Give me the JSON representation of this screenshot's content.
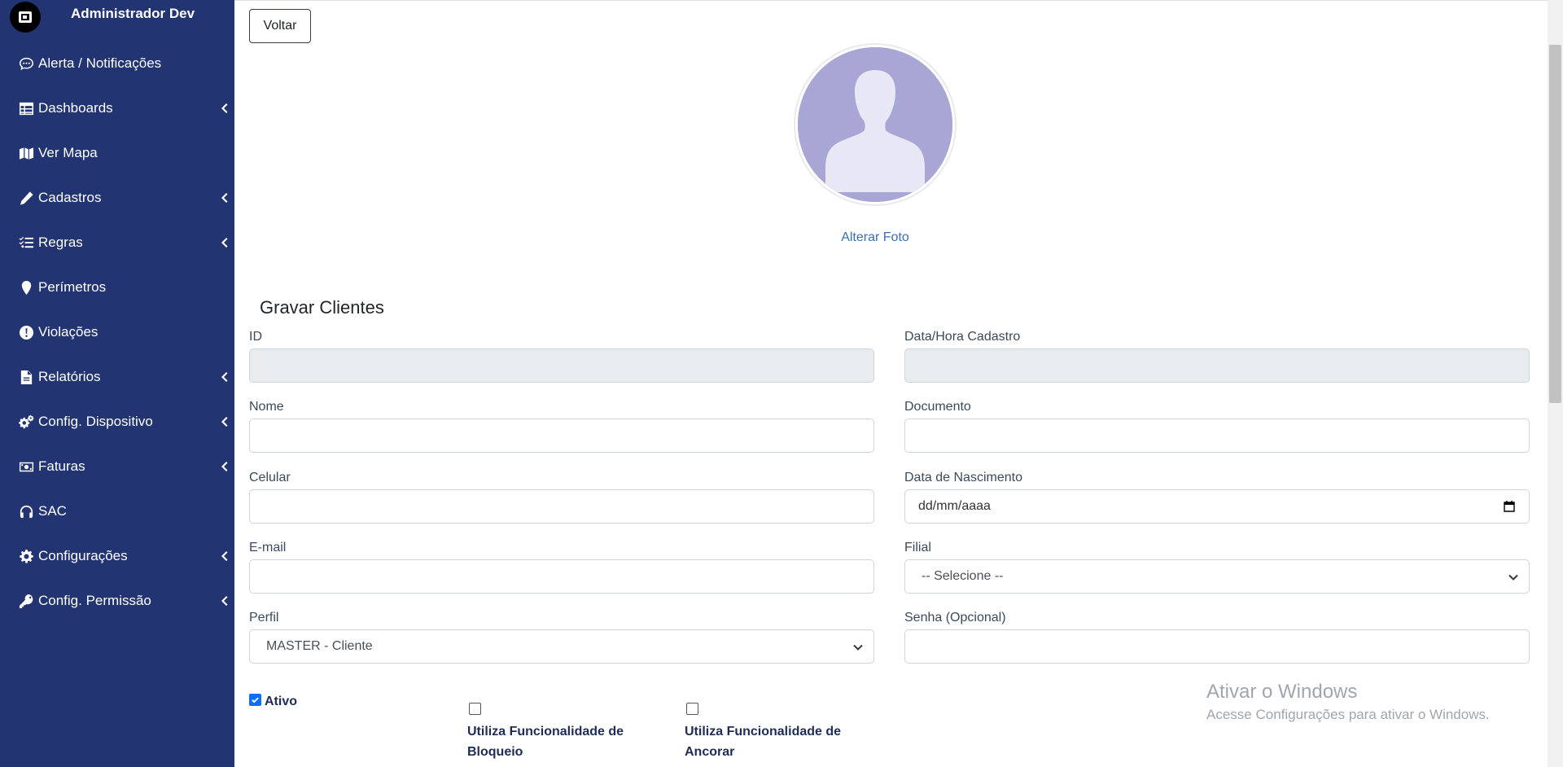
{
  "sidebar": {
    "user_name": "Administrador Dev",
    "items": [
      {
        "label": "Alerta / Notificações",
        "icon": "comment-dots-icon",
        "has_submenu": false
      },
      {
        "label": "Dashboards",
        "icon": "table-icon",
        "has_submenu": true
      },
      {
        "label": "Ver Mapa",
        "icon": "map-icon",
        "has_submenu": false
      },
      {
        "label": "Cadastros",
        "icon": "pencil-icon",
        "has_submenu": true
      },
      {
        "label": "Regras",
        "icon": "list-check-icon",
        "has_submenu": true
      },
      {
        "label": "Perímetros",
        "icon": "map-marker-icon",
        "has_submenu": false
      },
      {
        "label": "Violações",
        "icon": "exclamation-circle-icon",
        "has_submenu": false
      },
      {
        "label": "Relatórios",
        "icon": "file-icon",
        "has_submenu": true
      },
      {
        "label": "Config. Dispositivo",
        "icon": "cogs-icon",
        "has_submenu": true
      },
      {
        "label": "Faturas",
        "icon": "money-bill-icon",
        "has_submenu": true
      },
      {
        "label": "SAC",
        "icon": "headphones-icon",
        "has_submenu": false
      },
      {
        "label": "Configurações",
        "icon": "cog-icon",
        "has_submenu": true
      },
      {
        "label": "Config. Permissão",
        "icon": "key-icon",
        "has_submenu": true
      }
    ]
  },
  "main": {
    "back_button": "Voltar",
    "change_photo": "Alterar Foto",
    "form_title": "Gravar Clientes",
    "fields": {
      "id": {
        "label": "ID",
        "value": ""
      },
      "created_at": {
        "label": "Data/Hora Cadastro",
        "value": ""
      },
      "name": {
        "label": "Nome",
        "value": ""
      },
      "document": {
        "label": "Documento",
        "value": ""
      },
      "mobile": {
        "label": "Celular",
        "value": ""
      },
      "birth_date": {
        "label": "Data de Nascimento",
        "placeholder": "dd/mm/aaaa"
      },
      "email": {
        "label": "E-mail",
        "value": ""
      },
      "branch": {
        "label": "Filial",
        "selected": "-- Selecione --"
      },
      "profile": {
        "label": "Perfil",
        "selected": "MASTER - Cliente"
      },
      "password": {
        "label": "Senha (Opcional)",
        "value": ""
      }
    },
    "checkboxes": {
      "active": {
        "label": "Ativo",
        "checked": true
      },
      "lock": {
        "label": "Utiliza Funcionalidade de Bloqueio",
        "checked": false
      },
      "anchor": {
        "label": "Utiliza Funcionalidade de Ancorar",
        "checked": false
      }
    }
  },
  "watermark": {
    "title": "Ativar o Windows",
    "subtitle": "Acesse Configurações para ativar o Windows."
  },
  "colors": {
    "sidebar_bg": "#223471",
    "link": "#3a6fb0",
    "checkbox_checked": "#0d6efd"
  }
}
